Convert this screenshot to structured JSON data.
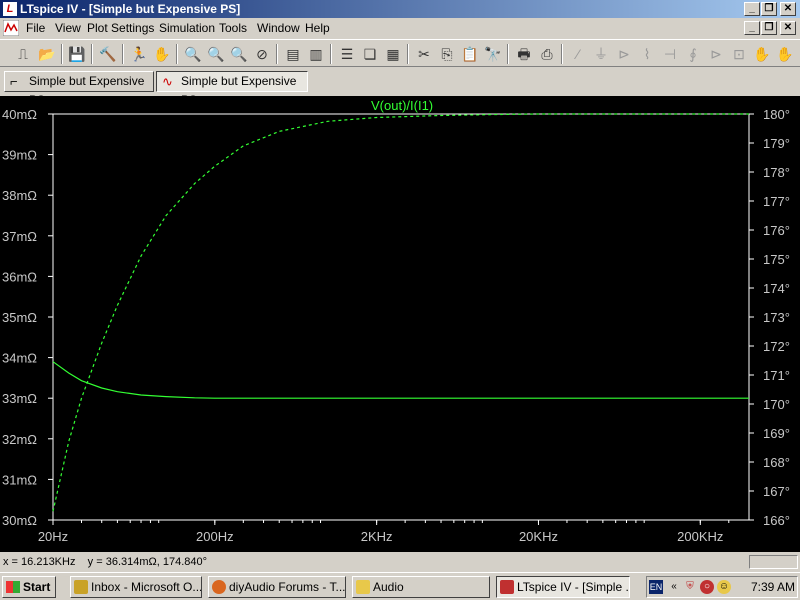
{
  "window": {
    "title": "LTspice IV - [Simple but Expensive PS]",
    "app_icon": "ltspice-icon"
  },
  "menu": {
    "items": [
      "File",
      "View",
      "Plot Settings",
      "Simulation",
      "Tools",
      "Window",
      "Help"
    ]
  },
  "toolbar": {
    "icons": [
      "schematic-icon",
      "open-icon",
      "save-icon",
      "control-panel-icon",
      "run-icon",
      "pan-icon",
      "zoom-in-icon",
      "zoom-out-icon",
      "zoom-out-2-icon",
      "zoom-cancel-icon",
      "autorange-icon",
      "fft-icon",
      "tile-horizontal-icon",
      "cascade-icon",
      "tile-vertical-icon",
      "cut-icon",
      "copy-icon",
      "paste-icon",
      "find-icon",
      "print-preview-icon",
      "print-icon",
      "wire-icon",
      "ground-icon",
      "label-icon",
      "resistor-icon",
      "capacitor-icon",
      "inductor-icon",
      "diode-icon",
      "component-icon",
      "move-icon",
      "drag-icon"
    ]
  },
  "tabs": [
    {
      "label": "Simple but Expensive PS",
      "icon": "schematic-icon",
      "active": false
    },
    {
      "label": "Simple but Expensive PS",
      "icon": "waveform-icon",
      "active": true
    }
  ],
  "chart_data": {
    "type": "line",
    "trace_label": "V(out)/I(I1)",
    "x_scale": "log",
    "x_ticks": [
      "20Hz",
      "200Hz",
      "2KHz",
      "20KHz",
      "200KHz"
    ],
    "xlim": [
      20,
      400000
    ],
    "y_left_ticks": [
      "40mΩ",
      "39mΩ",
      "38mΩ",
      "37mΩ",
      "36mΩ",
      "35mΩ",
      "34mΩ",
      "33mΩ",
      "32mΩ",
      "31mΩ",
      "30mΩ"
    ],
    "ylim_left": [
      30,
      40
    ],
    "y_right_ticks": [
      "180°",
      "179°",
      "178°",
      "177°",
      "176°",
      "175°",
      "174°",
      "173°",
      "172°",
      "171°",
      "170°",
      "169°",
      "168°",
      "167°",
      "166°"
    ],
    "ylim_right": [
      166,
      180
    ],
    "trace_color": "#33ff33",
    "series": [
      {
        "style": "solid",
        "axis": "left",
        "x": [
          20,
          25,
          30,
          40,
          50,
          70,
          100,
          150,
          200,
          300,
          500,
          1000,
          10000,
          100000,
          400000
        ],
        "y": [
          33.9,
          33.62,
          33.43,
          33.25,
          33.16,
          33.08,
          33.04,
          33.01,
          33.0,
          33.0,
          33.0,
          33.0,
          33.0,
          33.0,
          33.0
        ]
      },
      {
        "style": "dashed",
        "axis": "right",
        "x": [
          20,
          25,
          30,
          40,
          50,
          70,
          100,
          150,
          200,
          300,
          500,
          1000,
          2000,
          5000,
          10000,
          20000,
          50000,
          400000
        ],
        "y": [
          166.3,
          168.7,
          170.2,
          172.1,
          173.4,
          175.1,
          176.5,
          177.6,
          178.2,
          178.9,
          179.4,
          179.75,
          179.88,
          179.95,
          179.98,
          180.0,
          180.0,
          180.0
        ]
      }
    ]
  },
  "status": {
    "cursor_readout": "x = 16.213KHz    y = 36.314mΩ, 174.840°"
  },
  "taskbar": {
    "start_label": "Start",
    "buttons": [
      {
        "label": "Inbox - Microsoft O...",
        "icon": "outlook-icon",
        "color": "#c9a227"
      },
      {
        "label": "diyAudio Forums - T...",
        "icon": "firefox-icon",
        "color": "#d9661f"
      },
      {
        "label": "Audio",
        "icon": "folder-icon",
        "color": "#e8c84a"
      },
      {
        "label": "LTspice IV - [Simple ...",
        "icon": "ltspice-icon",
        "color": "#c03030",
        "active": true
      }
    ],
    "tray": {
      "lang": "EN",
      "clock": "7:39 AM"
    }
  }
}
